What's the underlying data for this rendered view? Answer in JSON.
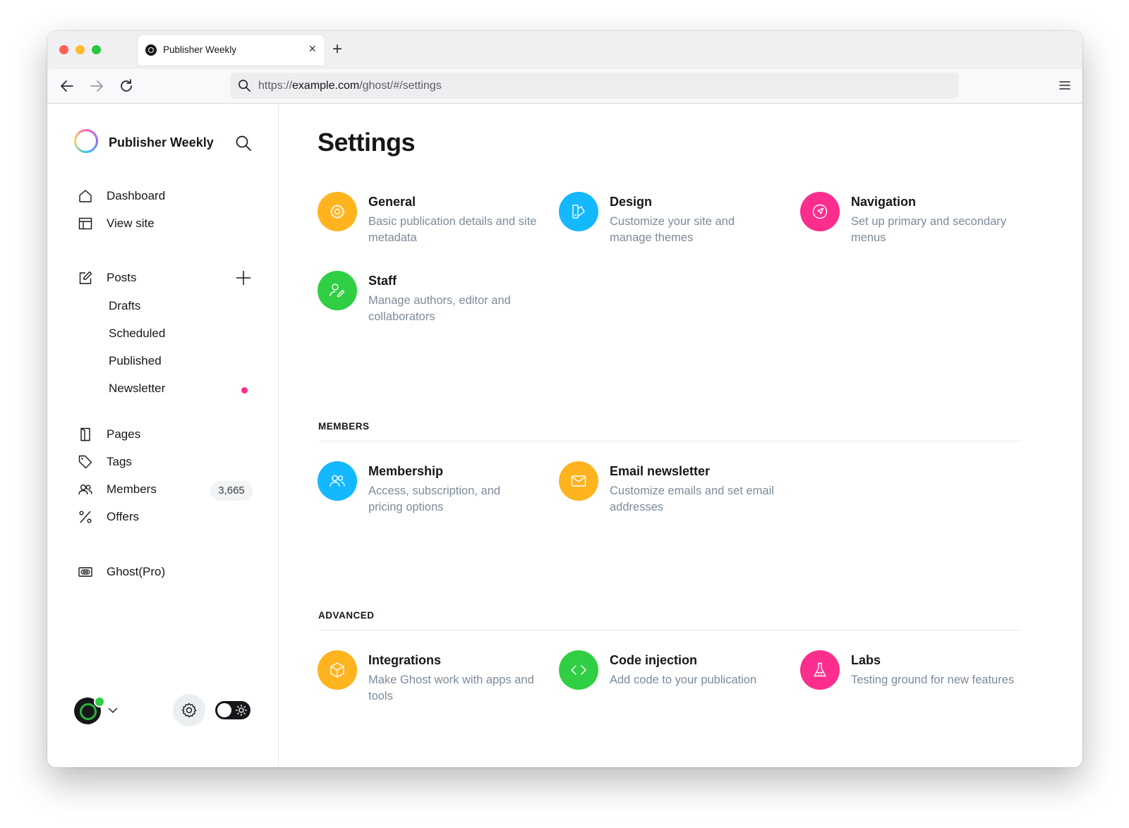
{
  "browser": {
    "tab_title": "Publisher Weekly",
    "url_scheme": "https://",
    "url_host": "example.com",
    "url_path": "/ghost/#/settings"
  },
  "sidebar": {
    "brand": "Publisher Weekly",
    "nav": [
      {
        "label": "Dashboard",
        "icon": "home-icon"
      },
      {
        "label": "View site",
        "icon": "layout-icon"
      }
    ],
    "posts": {
      "label": "Posts",
      "subitems": [
        "Drafts",
        "Scheduled",
        "Published",
        "Newsletter"
      ]
    },
    "more": [
      {
        "label": "Pages",
        "icon": "page-icon"
      },
      {
        "label": "Tags",
        "icon": "tag-icon"
      },
      {
        "label": "Members",
        "icon": "members-icon"
      },
      {
        "label": "Offers",
        "icon": "percent-icon"
      }
    ],
    "members_count": "3,665",
    "ghost_pro": "Ghost(Pro)"
  },
  "main": {
    "title": "Settings",
    "general_cards": [
      {
        "title": "General",
        "desc": "Basic publication details and site metadata",
        "color": "#ffb41f",
        "icon": "gear-icon"
      },
      {
        "title": "Design",
        "desc": "Customize your site and manage themes",
        "color": "#14b8ff",
        "icon": "brush-icon"
      },
      {
        "title": "Navigation",
        "desc": "Set up primary and secondary menus",
        "color": "#fb2d8d",
        "icon": "compass-icon"
      },
      {
        "title": "Staff",
        "desc": "Manage authors, editor and collaborators",
        "color": "#30cf43",
        "icon": "user-edit-icon"
      }
    ],
    "members_section": "MEMBERS",
    "members_cards": [
      {
        "title": "Membership",
        "desc": "Access, subscription, and pricing options",
        "color": "#14b8ff",
        "icon": "members-icon"
      },
      {
        "title": "Email newsletter",
        "desc": "Customize emails and set email addresses",
        "color": "#ffb41f",
        "icon": "envelope-icon"
      }
    ],
    "advanced_section": "ADVANCED",
    "advanced_cards": [
      {
        "title": "Integrations",
        "desc": "Make Ghost work with apps and tools",
        "color": "#ffb41f",
        "icon": "box-icon"
      },
      {
        "title": "Code injection",
        "desc": "Add code to your publication",
        "color": "#30cf43",
        "icon": "code-icon"
      },
      {
        "title": "Labs",
        "desc": "Testing ground for new features",
        "color": "#fb2d8d",
        "icon": "flask-icon"
      }
    ]
  }
}
